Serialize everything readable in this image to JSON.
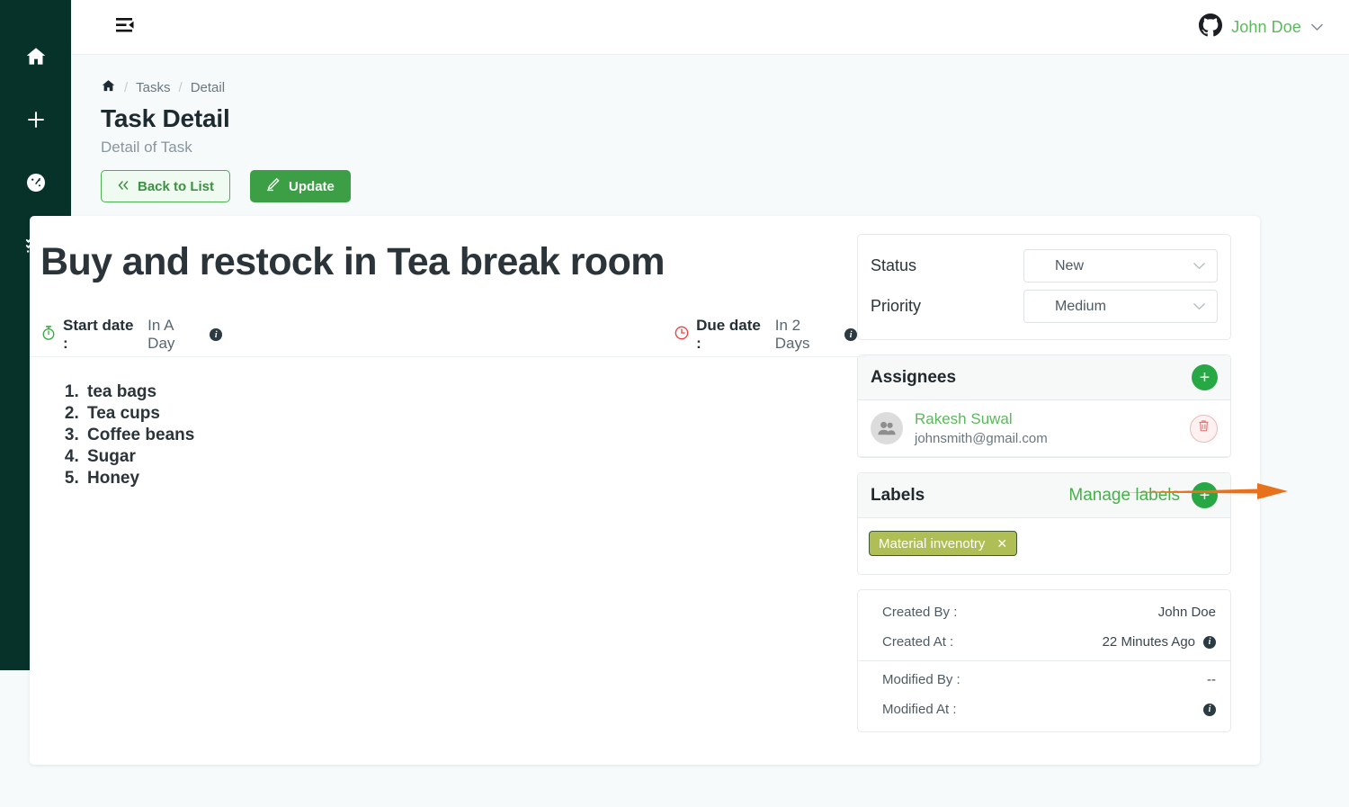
{
  "sidebar": {
    "items": [
      {
        "name": "home",
        "icon": "home-icon"
      },
      {
        "name": "add",
        "icon": "plus-icon"
      },
      {
        "name": "dashboard",
        "icon": "gauge-icon"
      },
      {
        "name": "tasks",
        "icon": "checklist-icon"
      }
    ]
  },
  "topbar": {
    "menu_icon": "menu-fold-icon",
    "account_icon": "github-logo-icon",
    "user_name": "John Doe",
    "chevron": "chevron-down-icon"
  },
  "breadcrumb": {
    "home_icon": "home-icon",
    "sep": "/",
    "items": [
      {
        "label": "Tasks"
      },
      {
        "label": "Detail"
      }
    ]
  },
  "header": {
    "title": "Task Detail",
    "subtitle": "Detail of Task"
  },
  "actions": {
    "back_label": "Back to List",
    "back_icon": "double-chevron-left-icon",
    "update_label": "Update",
    "update_icon": "pencil-icon"
  },
  "task": {
    "title": "Buy and restock in Tea break room",
    "start_date_label": "Start date :",
    "start_date_value": "In A Day",
    "start_date_icon": "stopwatch-icon",
    "due_date_label": "Due date :",
    "due_date_value": "In 2 Days",
    "due_date_icon": "clock-icon",
    "description_items": [
      "tea bags",
      "Tea cups",
      "Coffee beans",
      "Sugar",
      "Honey"
    ]
  },
  "fields": {
    "status_label": "Status",
    "status_value": "New",
    "priority_label": "Priority",
    "priority_value": "Medium"
  },
  "assignees": {
    "title": "Assignees",
    "add_icon": "plus-icon",
    "list": [
      {
        "name": "Rakesh Suwal",
        "email": "johnsmith@gmail.com",
        "avatar_icon": "users-avatar-icon",
        "delete_icon": "trash-icon"
      }
    ]
  },
  "labels": {
    "title": "Labels",
    "manage_label": "Manage labels",
    "add_icon": "plus-icon",
    "chips": [
      {
        "text": "Material invenotry",
        "remove_icon": "close-icon",
        "color": "#b0bf55"
      }
    ]
  },
  "meta": {
    "rows": [
      {
        "key": "Created By :",
        "value": "John Doe",
        "info": false
      },
      {
        "key": "Created At :",
        "value": "22 Minutes Ago",
        "info": true
      },
      {
        "key": "Modified By :",
        "value": "--",
        "info": false
      },
      {
        "key": "Modified At :",
        "value": "",
        "info": true
      }
    ]
  },
  "annotation": {
    "arrow_icon": "arrow-right-annotation",
    "color": "#e8721c"
  },
  "colors": {
    "rail_bg": "#06322a",
    "accent_green": "#28a745",
    "link_green": "#5cb85c",
    "page_bg": "#f6fafb",
    "danger": "#e96c6c"
  }
}
